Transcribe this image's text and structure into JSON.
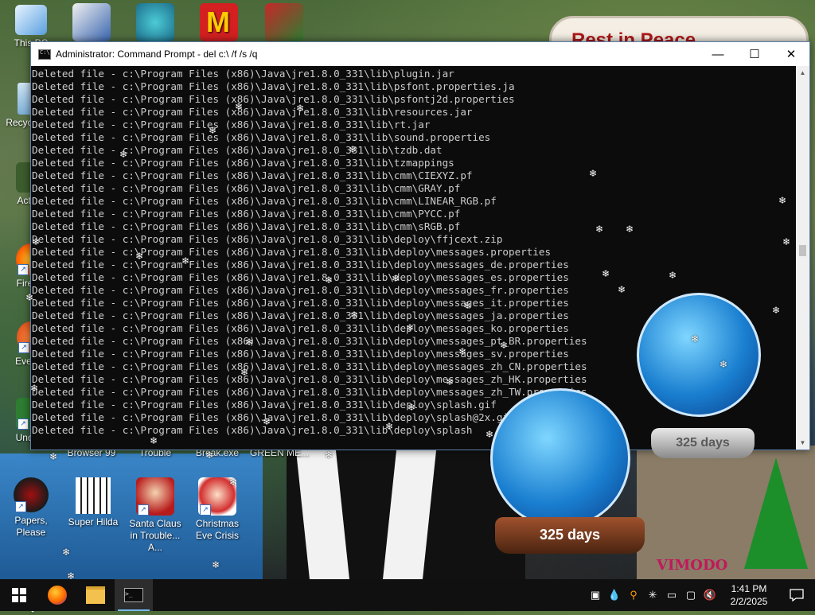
{
  "window": {
    "title": "Administrator: Command Prompt - del  c:\\ /f /s /q",
    "minimize": "—",
    "maximize": "☐",
    "close": "✕",
    "lines": [
      "Deleted file - c:\\Program Files (x86)\\Java\\jre1.8.0_331\\lib\\plugin.jar",
      "Deleted file - c:\\Program Files (x86)\\Java\\jre1.8.0_331\\lib\\psfont.properties.ja",
      "Deleted file - c:\\Program Files (x86)\\Java\\jre1.8.0_331\\lib\\psfontj2d.properties",
      "Deleted file - c:\\Program Files (x86)\\Java\\jre1.8.0_331\\lib\\resources.jar",
      "Deleted file - c:\\Program Files (x86)\\Java\\jre1.8.0_331\\lib\\rt.jar",
      "Deleted file - c:\\Program Files (x86)\\Java\\jre1.8.0_331\\lib\\sound.properties",
      "Deleted file - c:\\Program Files (x86)\\Java\\jre1.8.0_331\\lib\\tzdb.dat",
      "Deleted file - c:\\Program Files (x86)\\Java\\jre1.8.0_331\\lib\\tzmappings",
      "Deleted file - c:\\Program Files (x86)\\Java\\jre1.8.0_331\\lib\\cmm\\CIEXYZ.pf",
      "Deleted file - c:\\Program Files (x86)\\Java\\jre1.8.0_331\\lib\\cmm\\GRAY.pf",
      "Deleted file - c:\\Program Files (x86)\\Java\\jre1.8.0_331\\lib\\cmm\\LINEAR_RGB.pf",
      "Deleted file - c:\\Program Files (x86)\\Java\\jre1.8.0_331\\lib\\cmm\\PYCC.pf",
      "Deleted file - c:\\Program Files (x86)\\Java\\jre1.8.0_331\\lib\\cmm\\sRGB.pf",
      "Deleted file - c:\\Program Files (x86)\\Java\\jre1.8.0_331\\lib\\deploy\\ffjcext.zip",
      "Deleted file - c:\\Program Files (x86)\\Java\\jre1.8.0_331\\lib\\deploy\\messages.properties",
      "Deleted file - c:\\Program Files (x86)\\Java\\jre1.8.0_331\\lib\\deploy\\messages_de.properties",
      "Deleted file - c:\\Program Files (x86)\\Java\\jre1.8.0_331\\lib\\deploy\\messages_es.properties",
      "Deleted file - c:\\Program Files (x86)\\Java\\jre1.8.0_331\\lib\\deploy\\messages_fr.properties",
      "Deleted file - c:\\Program Files (x86)\\Java\\jre1.8.0_331\\lib\\deploy\\messages_it.properties",
      "Deleted file - c:\\Program Files (x86)\\Java\\jre1.8.0_331\\lib\\deploy\\messages_ja.properties",
      "Deleted file - c:\\Program Files (x86)\\Java\\jre1.8.0_331\\lib\\deploy\\messages_ko.properties",
      "Deleted file - c:\\Program Files (x86)\\Java\\jre1.8.0_331\\lib\\deploy\\messages_pt_BR.properties",
      "Deleted file - c:\\Program Files (x86)\\Java\\jre1.8.0_331\\lib\\deploy\\messages_sv.properties",
      "Deleted file - c:\\Program Files (x86)\\Java\\jre1.8.0_331\\lib\\deploy\\messages_zh_CN.properties",
      "Deleted file - c:\\Program Files (x86)\\Java\\jre1.8.0_331\\lib\\deploy\\messages_zh_HK.properties",
      "Deleted file - c:\\Program Files (x86)\\Java\\jre1.8.0_331\\lib\\deploy\\messages_zh_TW.properties",
      "Deleted file - c:\\Program Files (x86)\\Java\\jre1.8.0_331\\lib\\deploy\\splash.gif",
      "Deleted file - c:\\Program Files (x86)\\Java\\jre1.8.0_331\\lib\\deploy\\splash@2x.gif",
      "Deleted file - c:\\Program Files (x86)\\Java\\jre1.8.0_331\\lib\\deploy\\splash"
    ]
  },
  "desktop": {
    "left_icons": [
      {
        "label": "This PC"
      },
      {
        "label": "Recycle Bin"
      },
      {
        "label": "Activ..."
      },
      {
        "label": "Firefox"
      },
      {
        "label": "Every..."
      },
      {
        "label": "Unde..."
      }
    ],
    "top_icons": [
      {
        "label": "Browser 99"
      },
      {
        "label": "Trouble"
      },
      {
        "label": "Break.exe"
      },
      {
        "label": "GREEN ME..."
      }
    ],
    "bottom_icons": [
      {
        "label": "Papers, Please"
      },
      {
        "label": "Super Hilda"
      },
      {
        "label": "Santa Claus in Trouble... A..."
      },
      {
        "label": "Christmas Eve Crisis"
      }
    ],
    "wallpaper_sign": "Rest in Peace",
    "globe_days_small": "325 days",
    "globe_days_large": "325 days",
    "vimodo": "VIMODO"
  },
  "taskbar": {
    "time": "1:41 PM",
    "date": "2/2/2025"
  },
  "colors": {
    "console_bg": "#0c0c0c",
    "console_text": "#cccccc",
    "taskbar_bg": "#101010",
    "accent": "#76b9ed"
  }
}
